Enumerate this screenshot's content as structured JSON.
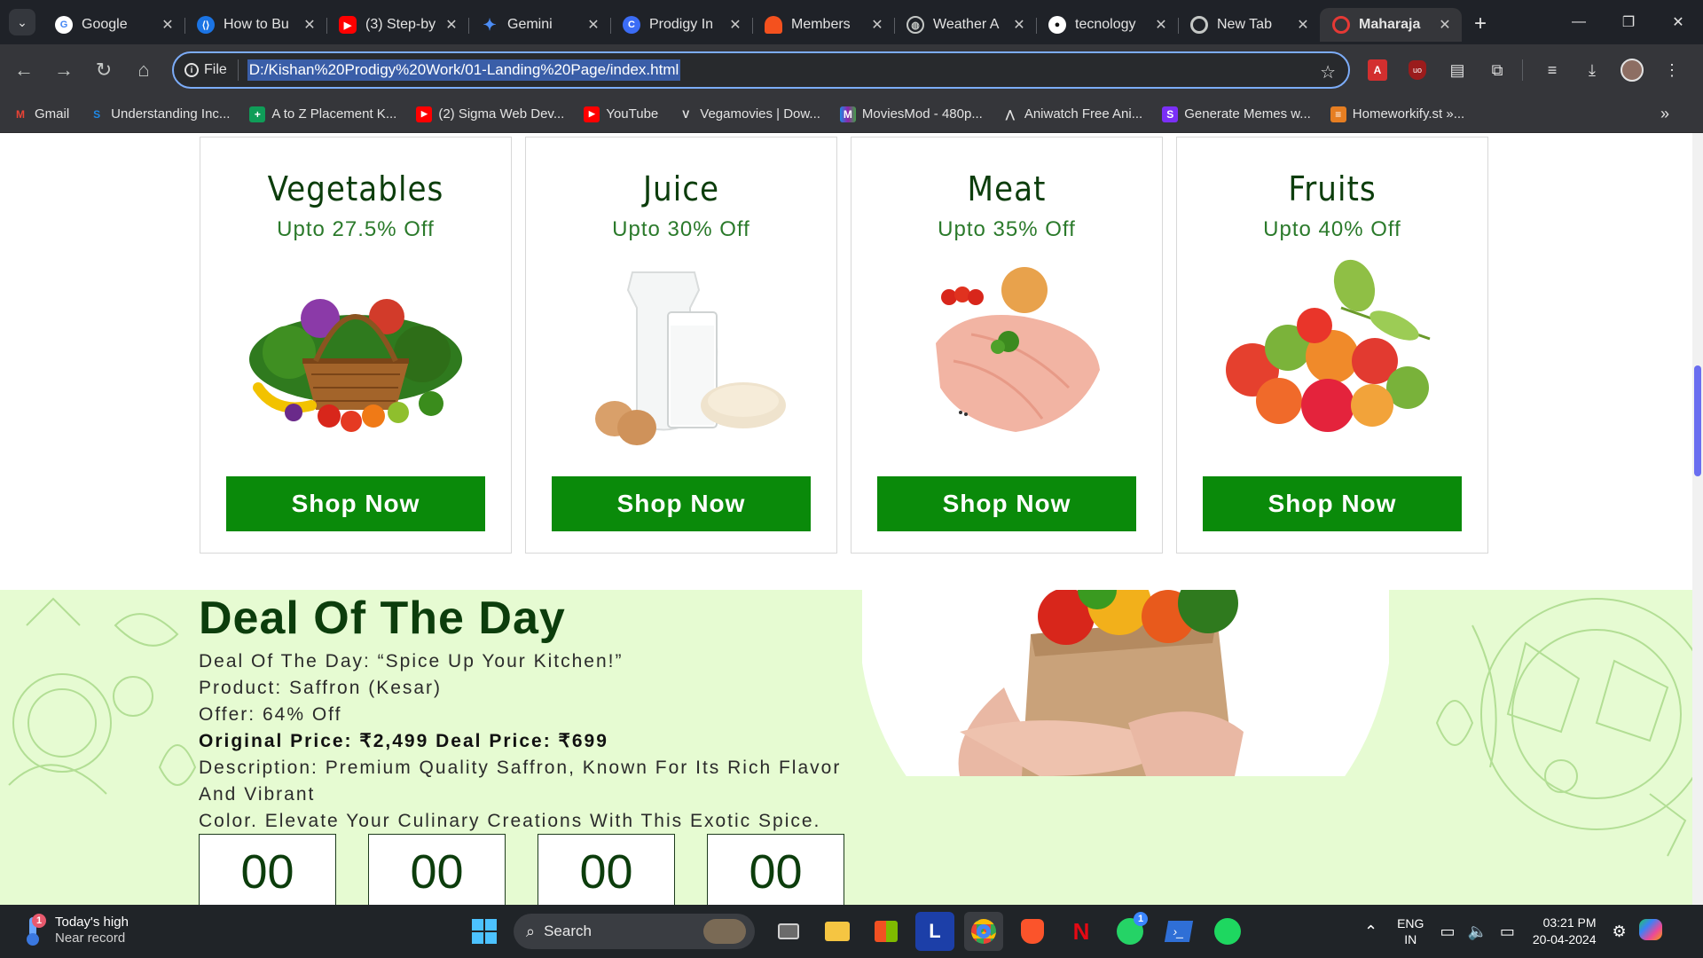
{
  "browser": {
    "tabs": [
      {
        "title": "Google",
        "favicon": "google-icon",
        "color": "#ffffff"
      },
      {
        "title": "How to Bu",
        "favicon": "code-icon",
        "color": "#1b74e4"
      },
      {
        "title": "(3) Step-by",
        "favicon": "youtube-icon",
        "color": "#ff0000"
      },
      {
        "title": "Gemini",
        "favicon": "gemini-icon",
        "color": "#4c8df6"
      },
      {
        "title": "Prodigy In",
        "favicon": "prodigy-icon",
        "color": "#3b6cf5"
      },
      {
        "title": "Members",
        "favicon": "members-icon",
        "color": "#f4511e"
      },
      {
        "title": "Weather A",
        "favicon": "globe-icon",
        "color": "#9aa0a6"
      },
      {
        "title": "tecnology",
        "favicon": "github-icon",
        "color": "#ffffff"
      },
      {
        "title": "New Tab",
        "favicon": "chrome-icon",
        "color": "#9aa0a6"
      },
      {
        "title": "Maharaja",
        "favicon": "maharaja-icon",
        "color": "#e53935",
        "active": true
      }
    ],
    "omnibox": {
      "scheme_label": "File",
      "url": "D:/Kishan%20Prodigy%20Work/01-Landing%20Page/index.html"
    },
    "bookmarks": [
      {
        "label": "Gmail",
        "icon": "gmail-icon",
        "color": "#ea4335"
      },
      {
        "label": "Understanding Inc...",
        "icon": "s-icon",
        "color": "#1e88e5"
      },
      {
        "label": "A to Z Placement K...",
        "icon": "plus-icon",
        "color": "#0f9d58"
      },
      {
        "label": "(2) Sigma Web Dev...",
        "icon": "youtube-icon",
        "color": "#ff0000"
      },
      {
        "label": "YouTube",
        "icon": "youtube-icon",
        "color": "#ff0000"
      },
      {
        "label": "Vegamovies | Dow...",
        "icon": "v-icon",
        "color": "#6a1b9a"
      },
      {
        "label": "MoviesMod - 480p...",
        "icon": "m-icon",
        "color": "#8e24aa"
      },
      {
        "label": "Aniwatch Free Ani...",
        "icon": "aniwatch-icon",
        "color": "#9aa0a6"
      },
      {
        "label": "Generate Memes w...",
        "icon": "s-icon",
        "color": "#7b2ff7"
      },
      {
        "label": "Homeworkify.st »...",
        "icon": "books-icon",
        "color": "#e67e22"
      }
    ],
    "bookmark_overflow": "»"
  },
  "page": {
    "categories": [
      {
        "name": "Vegetables",
        "offer": "Upto 27.5% Off",
        "button": "Shop Now",
        "art": "vegetable-basket"
      },
      {
        "name": "Juice",
        "offer": "Upto 30% Off",
        "button": "Shop Now",
        "art": "milk-jug"
      },
      {
        "name": "Meat",
        "offer": "Upto 35% Off",
        "button": "Shop Now",
        "art": "chicken-breast"
      },
      {
        "name": "Fruits",
        "offer": "Upto 40% Off",
        "button": "Shop Now",
        "art": "fruit-pile"
      }
    ],
    "deal": {
      "title": "Deal Of The Day",
      "line1": "Deal Of The Day: “Spice Up Your Kitchen!”",
      "line2": "Product: Saffron (Kesar)",
      "line3": "Offer: 64% Off",
      "line4": "Original Price: ₹2,499 Deal Price: ₹699",
      "line5": "Description: Premium Quality Saffron, Known For Its Rich Flavor And Vibrant",
      "line6": "Color. Elevate Your Culinary Creations With This Exotic Spice.",
      "timer": [
        "00",
        "00",
        "00",
        "00"
      ]
    },
    "colors": {
      "heading_green": "#0c3d0c",
      "button_green": "#0a8a0a",
      "deal_bg": "#e6fbd2"
    }
  },
  "taskbar": {
    "weather_title": "Today's high",
    "weather_sub": "Near record",
    "weather_badge": "1",
    "search_placeholder": "Search",
    "whatsapp_badge": "1",
    "lang_top": "ENG",
    "lang_bottom": "IN",
    "time": "03:21 PM",
    "date": "20-04-2024"
  }
}
